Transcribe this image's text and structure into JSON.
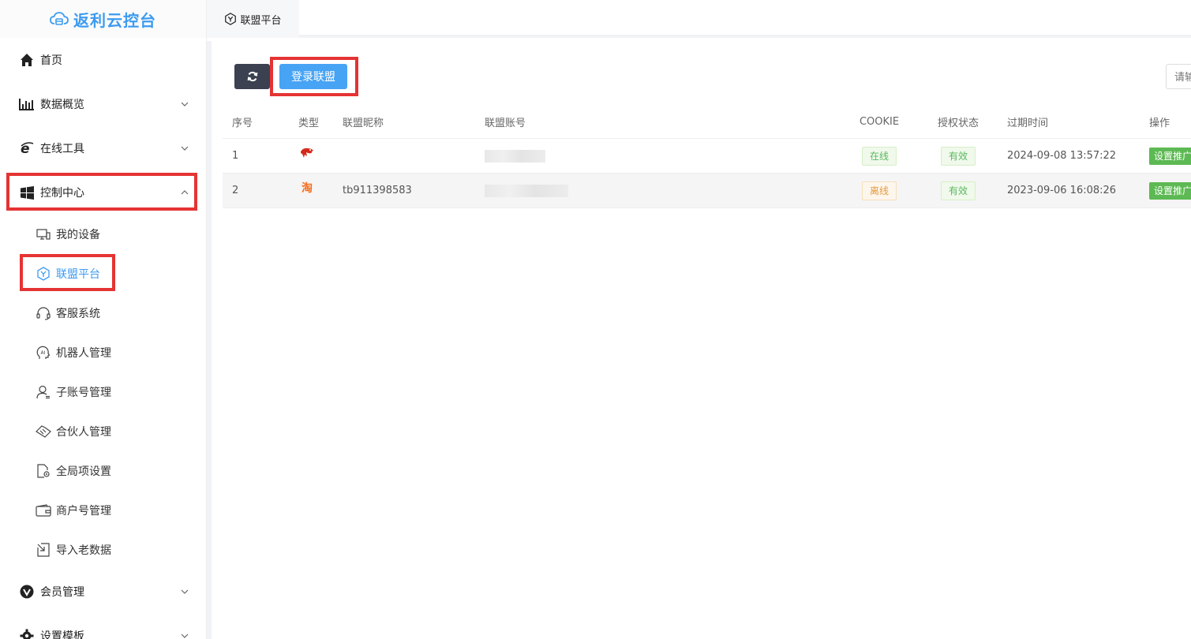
{
  "app": {
    "title": "返利云控台"
  },
  "tabs": [
    {
      "label": "联盟平台"
    }
  ],
  "sidebar": {
    "items": [
      {
        "label": "首页",
        "icon": "home-icon"
      },
      {
        "label": "数据概览",
        "icon": "bar-chart-icon"
      },
      {
        "label": "在线工具",
        "icon": "ie-icon"
      },
      {
        "label": "控制中心",
        "icon": "windows-icon"
      },
      {
        "label": "会员管理",
        "icon": "vip-icon"
      },
      {
        "label": "设置模板",
        "icon": "gear-icon"
      }
    ],
    "sub_items": [
      {
        "label": "我的设备",
        "icon": "monitor-icon"
      },
      {
        "label": "联盟平台",
        "icon": "alliance-icon"
      },
      {
        "label": "客服系统",
        "icon": "headset-icon"
      },
      {
        "label": "机器人管理",
        "icon": "ai-icon"
      },
      {
        "label": "子账号管理",
        "icon": "user-icon"
      },
      {
        "label": "合伙人管理",
        "icon": "handshake-icon"
      },
      {
        "label": "全局项设置",
        "icon": "file-settings-icon"
      },
      {
        "label": "商户号管理",
        "icon": "wallet-icon"
      },
      {
        "label": "导入老数据",
        "icon": "import-icon"
      }
    ]
  },
  "toolbar": {
    "login_label": "登录联盟",
    "search_placeholder": "请输入"
  },
  "table": {
    "headers": [
      "序号",
      "类型",
      "联盟昵称",
      "联盟账号",
      "COOKIE",
      "授权状态",
      "过期时间",
      "操作"
    ],
    "rows": [
      {
        "idx": "1",
        "type": "jingdong",
        "nick": "",
        "cookie": "在线",
        "auth": "有效",
        "expire": "2024-09-08 13:57:22",
        "op": "设置推广"
      },
      {
        "idx": "2",
        "type": "taobao",
        "type_label": "淘",
        "nick": "tb911398583",
        "cookie": "离线",
        "auth": "有效",
        "expire": "2023-09-06 16:08:26",
        "op": "设置推广"
      }
    ]
  },
  "colors": {
    "accent": "#3d9bf0",
    "highlight": "#e53333",
    "success": "#5db953",
    "dark_button": "#3b4151"
  }
}
